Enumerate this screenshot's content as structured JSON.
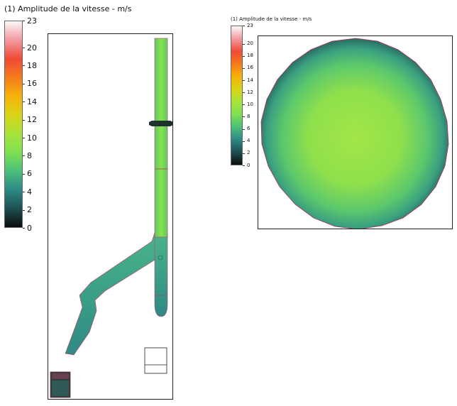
{
  "left_view": {
    "legend": {
      "title": "(1) Amplitude de la vitesse - m/s",
      "ticks": [
        "23",
        "20",
        "18",
        "16",
        "14",
        "12",
        "10",
        "8",
        "6",
        "4",
        "2",
        "0"
      ]
    }
  },
  "right_view": {
    "legend": {
      "title": "(1) Amplitude de la vitesse - m/s",
      "ticks": [
        "23",
        "20",
        "18",
        "16",
        "14",
        "12",
        "10",
        "8",
        "6",
        "4",
        "2",
        "0"
      ]
    }
  },
  "colormap": {
    "max": 23,
    "min": 0,
    "stops": [
      "#fbf7f8",
      "#f29aa0",
      "#f04a35",
      "#f57b1c",
      "#f6b20a",
      "#d9d416",
      "#a8e33a",
      "#7fe050",
      "#4cc07a",
      "#2d8a86",
      "#1e4f52",
      "#0a0d0d"
    ]
  },
  "colors": {
    "pipe_main": "#86e04a",
    "pipe_lower": "#3fb58c",
    "disc_center": "#9fe548",
    "disc_edge": "#244e55"
  }
}
